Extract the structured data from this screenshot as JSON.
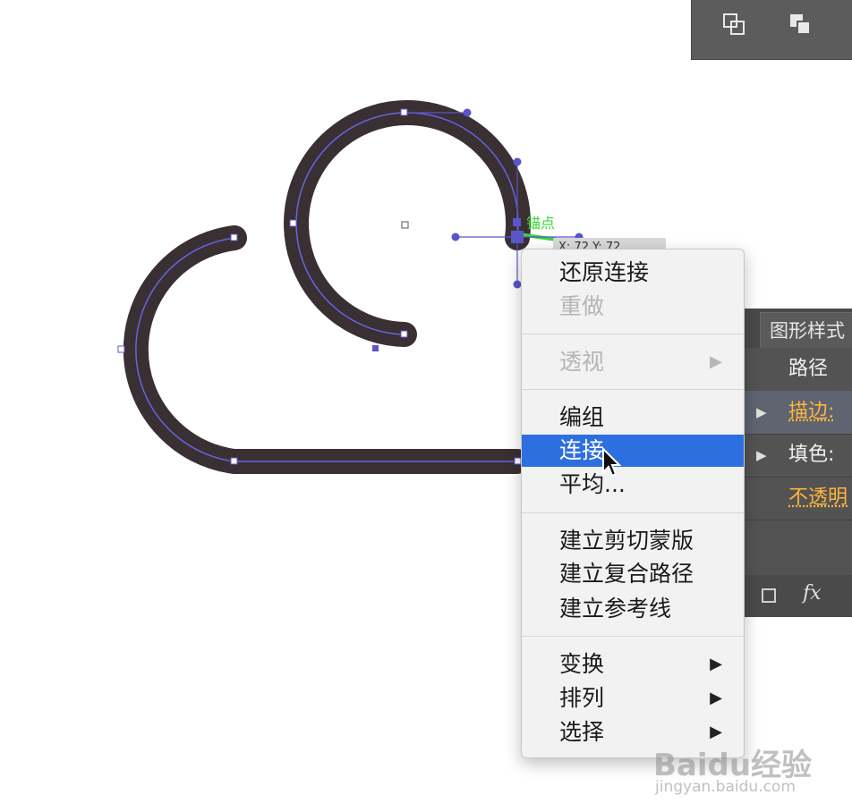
{
  "context_menu": {
    "items": [
      {
        "label": "还原连接",
        "enabled": true
      },
      {
        "label": "重做",
        "enabled": false
      },
      {
        "label": "透视",
        "enabled": false,
        "submenu": true
      },
      {
        "label": "编组",
        "enabled": true
      },
      {
        "label": "连接",
        "enabled": true,
        "highlighted": true
      },
      {
        "label": "平均...",
        "enabled": true
      },
      {
        "label": "建立剪切蒙版",
        "enabled": true
      },
      {
        "label": "建立复合路径",
        "enabled": true
      },
      {
        "label": "建立参考线",
        "enabled": true
      },
      {
        "label": "变换",
        "enabled": true,
        "submenu": true
      },
      {
        "label": "排列",
        "enabled": true,
        "submenu": true
      },
      {
        "label": "选择",
        "enabled": true,
        "submenu": true
      }
    ],
    "submenu_arrow": "▶",
    "highlight_color": "#2e6fe0"
  },
  "appearance_panel": {
    "tab_label": "图形样式",
    "header": "路径",
    "rows": [
      {
        "label": "描边:",
        "expander": "▶"
      },
      {
        "label": "填色:",
        "expander": "▶"
      },
      {
        "label": "不透明"
      }
    ],
    "footer_fx": "fx"
  },
  "smart_guide": {
    "anchor_label": "锚点",
    "coordinates": "X: 72 Y: 72"
  },
  "toolbar_icons": [
    "pathfinder-minus-back-icon",
    "pathfinder-crop-icon"
  ],
  "watermark": {
    "text": "Baidu经验",
    "url": "jingyan.baidu.com"
  },
  "colors": {
    "stroke": "#3a2f33",
    "path_outline": "#6a63e0",
    "panel_bg": "#535353",
    "accent_orange": "#ffb43c"
  }
}
